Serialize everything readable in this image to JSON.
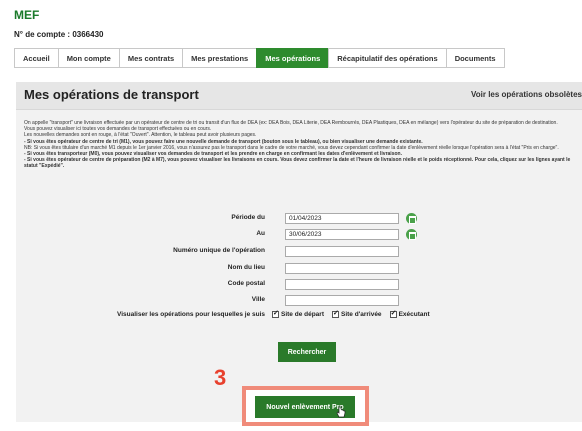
{
  "header": {
    "brand": "MEF",
    "account_label": "N° de compte : 0366430"
  },
  "tabs": [
    {
      "label": "Accueil"
    },
    {
      "label": "Mon compte"
    },
    {
      "label": "Mes contrats"
    },
    {
      "label": "Mes prestations"
    },
    {
      "label": "Mes opérations",
      "active": true
    },
    {
      "label": "Récapitulatif des opérations"
    },
    {
      "label": "Documents"
    }
  ],
  "page": {
    "title": "Mes opérations de transport",
    "obsolete_link": "Voir les opérations obsolètes"
  },
  "info_lines": [
    "On appelle \"transport\" une livraison effectuée par un opérateur de centre de tri ou transit d'un flux de DEA (ex: DEA Bois, DEA Literie, DEA Rembourrés, DEA Plastiques, DEA en mélange) vers l'opérateur du site de préparation de destination.",
    "Vous pouvez visualiser ici toutes vos demandes de transport effectuées ou en cours.",
    "Les nouvelles demandes sont en rouge, à l'état \"Ouvert\". Attention, le tableau peut avoir plusieurs pages.",
    "- Si vous êtes opérateur de centre de tri (M1), vous pouvez faire une nouvelle demande de transport (bouton sous le tableau), ou bien visualiser une demande existante.",
    "NB: Si vous êtes titulaire d'un marché M1 depuis le 1er janvier 2016, vous n'assurez pas le transport dans le cadre de votre marché, vous devez cependant confirmer la date d'enlèvement réelle lorsque l'opération sera à l'état \"Pris en charge\".",
    "- Si vous êtes transporteur (M0), vous pouvez visualiser vos demandes de transport et les prendre en charge en confirmant les dates d'enlèvement et livraison.",
    "- Si vous êtes opérateur de centre de préparation (M2 à M7), vous pouvez visualiser les livraisons en cours. Vous devez confirmer la date et l'heure de livraison réelle et le poids réceptionné. Pour cela, cliquez sur les lignes ayant le statut \"Expédié\"."
  ],
  "form": {
    "period_from_label": "Période du",
    "period_from_value": "01/04/2023",
    "period_to_label": "Au",
    "period_to_value": "30/06/2023",
    "operation_number_label": "Numéro unique de l'opération",
    "site_name_label": "Nom du lieu",
    "postal_code_label": "Code postal",
    "city_label": "Ville",
    "visualize_label": "Visualiser les opérations pour lesquelles je suis",
    "checkboxes": [
      {
        "label": "Site de départ",
        "checked": true
      },
      {
        "label": "Site d'arrivée",
        "checked": true
      },
      {
        "label": "Exécutant",
        "checked": true
      }
    ],
    "search_button": "Rechercher"
  },
  "annotation": {
    "step_number": "3"
  },
  "actions": {
    "new_pickup_button": "Nouvel enlèvement Pro"
  },
  "colors": {
    "brand_green": "#2e8b2e",
    "button_green": "#2a7a2a",
    "annotation_red": "#e8412e",
    "highlight_border": "#f08b7a"
  }
}
